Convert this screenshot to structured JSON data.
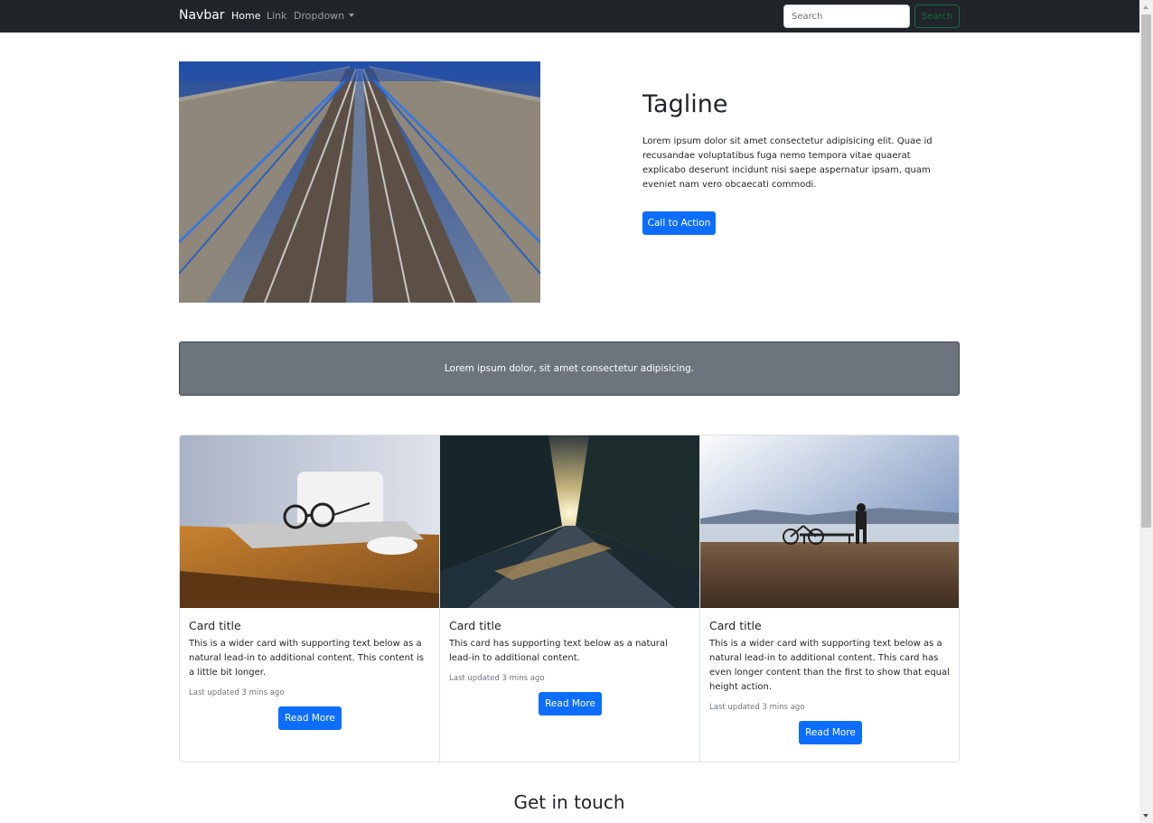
{
  "navbar": {
    "brand": "Navbar",
    "links": [
      {
        "label": "Home",
        "active": true
      },
      {
        "label": "Link",
        "active": false
      },
      {
        "label": "Dropdown",
        "active": false
      }
    ],
    "search": {
      "placeholder": "Search",
      "value": "",
      "button_label": "Search"
    }
  },
  "hero": {
    "image": "railway-tracks-photo",
    "tagline": "Tagline",
    "text": "Lorem ipsum dolor sit amet consectetur adipisicing elit. Quae id recusandae voluptatibus fuga nemo tempora vitae quaerat explicabo deserunt incidunt nisi saepe aspernatur ipsam, quam eveniet nam vero obcaecati commodi.",
    "cta_label": "Call to Action"
  },
  "banner": {
    "text": "Lorem ipsum dolor, sit amet consectetur adipisicing."
  },
  "cards": [
    {
      "image": "laptop-glasses-mouse-photo",
      "title": "Card title",
      "text": "This is a wider card with supporting text below as a natural lead-in to additional content. This content is a little bit longer.",
      "updated": "Last updated 3 mins ago",
      "button_label": "Read More"
    },
    {
      "image": "tree-lined-road-sunrise-photo",
      "title": "Card title",
      "text": "This card has supporting text below as a natural lead-in to additional content.",
      "updated": "Last updated 3 mins ago",
      "button_label": "Read More"
    },
    {
      "image": "lakeside-bicycle-photo",
      "title": "Card title",
      "text": "This is a wider card with supporting text below as a natural lead-in to additional content. This card has even longer content than the first to show that equal height action.",
      "updated": "Last updated 3 mins ago",
      "button_label": "Read More"
    }
  ],
  "contact": {
    "heading": "Get in touch"
  },
  "colors": {
    "navbar_bg": "#212529",
    "primary": "#0d6efd",
    "banner_bg": "#6c757d",
    "search_button": "#146c43"
  }
}
